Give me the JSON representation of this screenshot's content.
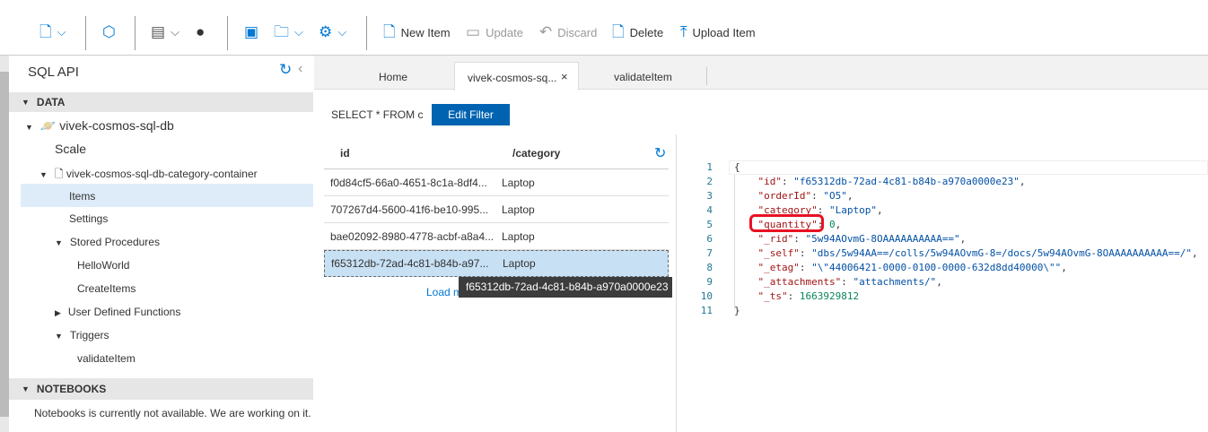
{
  "toolbar": {
    "items": [
      {
        "icon": "new-container-icon",
        "chevron": true
      },
      {
        "icon": "cosmos-icon"
      },
      {
        "icon": "notebook-icon",
        "chevron": true
      },
      {
        "icon": "github-icon"
      },
      {
        "icon": "new-query-icon"
      },
      {
        "icon": "open-query-icon",
        "chevron": true
      },
      {
        "icon": "settings-icon",
        "chevron": true
      }
    ],
    "new_item": "New Item",
    "update": "Update",
    "discard": "Discard",
    "delete": "Delete",
    "upload_item": "Upload Item"
  },
  "sidebar": {
    "title": "SQL API",
    "data_section": "DATA",
    "database": "vivek-cosmos-sql-db",
    "scale": "Scale",
    "container": "vivek-cosmos-sql-db-category-container",
    "items": "Items",
    "settings": "Settings",
    "stored_procedures": "Stored Procedures",
    "sprocs": [
      "HelloWorld",
      "CreateItems"
    ],
    "udf": "User Defined Functions",
    "triggers": "Triggers",
    "trigger_items": [
      "validateItem"
    ],
    "notebooks_section": "NOTEBOOKS",
    "notebooks_msg": "Notebooks is currently not available. We are working on it."
  },
  "tabs": [
    {
      "label": "Home"
    },
    {
      "label": "vivek-cosmos-sq...",
      "active": true,
      "close": "×"
    },
    {
      "label": "validateItem"
    }
  ],
  "query": {
    "text": "SELECT * FROM c",
    "edit_filter": "Edit Filter"
  },
  "table": {
    "columns": [
      "id",
      "/category"
    ],
    "rows": [
      [
        "f0d84cf5-66a0-4651-8c1a-8df4...",
        "Laptop"
      ],
      [
        "707267d4-5600-41f6-be10-995...",
        "Laptop"
      ],
      [
        "bae02092-8980-4778-acbf-a8a4...",
        "Laptop"
      ],
      [
        "f65312db-72ad-4c81-b84b-a97...",
        "Laptop"
      ]
    ],
    "selected_index": 3,
    "load_more": "Load more",
    "tooltip": "f65312db-72ad-4c81-b84b-a970a0000e23"
  },
  "editor": {
    "lines": [
      {
        "n": "1",
        "parts": [
          [
            "p",
            "{"
          ]
        ]
      },
      {
        "n": "2",
        "parts": [
          [
            "k",
            "    \"id\""
          ],
          [
            "p",
            ": "
          ],
          [
            "s",
            "\"f65312db-72ad-4c81-b84b-a970a0000e23\""
          ],
          [
            "p",
            ","
          ]
        ]
      },
      {
        "n": "3",
        "parts": [
          [
            "k",
            "    \"orderId\""
          ],
          [
            "p",
            ": "
          ],
          [
            "s",
            "\"O5\""
          ],
          [
            "p",
            ","
          ]
        ]
      },
      {
        "n": "4",
        "parts": [
          [
            "k",
            "    \"category\""
          ],
          [
            "p",
            ": "
          ],
          [
            "s",
            "\"Laptop\""
          ],
          [
            "p",
            ","
          ]
        ]
      },
      {
        "n": "5",
        "parts": [
          [
            "k",
            "    \"quantity\""
          ],
          [
            "p",
            ": "
          ],
          [
            "n",
            "0"
          ],
          [
            "p",
            ","
          ]
        ]
      },
      {
        "n": "6",
        "parts": [
          [
            "k",
            "    \"_rid\""
          ],
          [
            "p",
            ": "
          ],
          [
            "s",
            "\"5w94AOvmG-8OAAAAAAAAAA==\""
          ],
          [
            "p",
            ","
          ]
        ]
      },
      {
        "n": "7",
        "parts": [
          [
            "k",
            "    \"_self\""
          ],
          [
            "p",
            ": "
          ],
          [
            "s",
            "\"dbs/5w94AA==/colls/5w94AOvmG-8=/docs/5w94AOvmG-8OAAAAAAAAAA==/\""
          ],
          [
            "p",
            ","
          ]
        ]
      },
      {
        "n": "8",
        "parts": [
          [
            "k",
            "    \"_etag\""
          ],
          [
            "p",
            ": "
          ],
          [
            "s",
            "\"\\\"44006421-0000-0100-0000-632d8dd40000\\\"\""
          ],
          [
            "p",
            ","
          ]
        ]
      },
      {
        "n": "9",
        "parts": [
          [
            "k",
            "    \"_attachments\""
          ],
          [
            "p",
            ": "
          ],
          [
            "s",
            "\"attachments/\""
          ],
          [
            "p",
            ","
          ]
        ]
      },
      {
        "n": "10",
        "parts": [
          [
            "k",
            "    \"_ts\""
          ],
          [
            "p",
            ": "
          ],
          [
            "n",
            "1663929812"
          ]
        ]
      },
      {
        "n": "11",
        "parts": [
          [
            "p",
            "}"
          ]
        ]
      }
    ],
    "highlighted_line": 5,
    "highlight_color": "#e81123"
  },
  "colors": {
    "accent": "#0063b1",
    "selected_row": "#c7e0f4",
    "selected_tree": "#deecf9"
  }
}
